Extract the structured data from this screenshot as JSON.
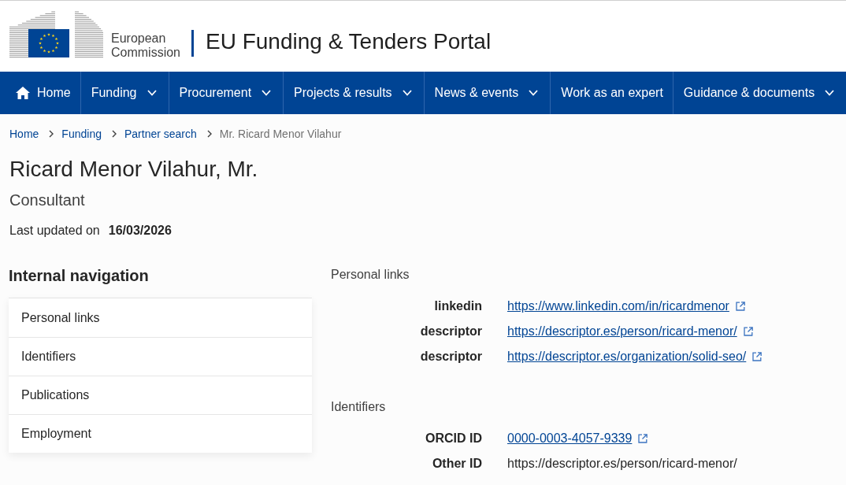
{
  "header": {
    "logo_lines": [
      "European",
      "Commission"
    ],
    "portal_title": "EU Funding & Tenders Portal"
  },
  "main_nav": [
    {
      "label": "Home",
      "kind": "home"
    },
    {
      "label": "Funding",
      "kind": "dropdown"
    },
    {
      "label": "Procurement",
      "kind": "dropdown"
    },
    {
      "label": "Projects & results",
      "kind": "dropdown"
    },
    {
      "label": "News & events",
      "kind": "dropdown"
    },
    {
      "label": "Work as an expert",
      "kind": "link"
    },
    {
      "label": "Guidance & documents",
      "kind": "dropdown"
    }
  ],
  "breadcrumb": [
    {
      "label": "Home",
      "kind": "link"
    },
    {
      "label": "Funding",
      "kind": "link"
    },
    {
      "label": "Partner search",
      "kind": "link"
    },
    {
      "label": "Mr. Ricard Menor Vilahur",
      "kind": "current"
    }
  ],
  "profile": {
    "name": "Ricard Menor Vilahur, Mr.",
    "role": "Consultant",
    "last_updated_label": "Last updated on",
    "last_updated_date": "16/03/2026"
  },
  "internal_navigation": {
    "title": "Internal navigation",
    "items": [
      "Personal links",
      "Identifiers",
      "Publications",
      "Employment"
    ]
  },
  "sections": [
    {
      "title": "Personal links",
      "rows": [
        {
          "label": "linkedin",
          "value": "https://www.linkedin.com/in/ricardmenor",
          "kind": "link"
        },
        {
          "label": "descriptor",
          "value": "https://descriptor.es/person/ricard-menor/",
          "kind": "link"
        },
        {
          "label": "descriptor",
          "value": "https://descriptor.es/organization/solid-seo/",
          "kind": "link"
        }
      ]
    },
    {
      "title": "Identifiers",
      "rows": [
        {
          "label": "ORCID ID",
          "value": "0000-0003-4057-9339",
          "kind": "link"
        },
        {
          "label": "Other ID",
          "value": "https://descriptor.es/person/ricard-menor/",
          "kind": "text"
        }
      ]
    }
  ]
}
